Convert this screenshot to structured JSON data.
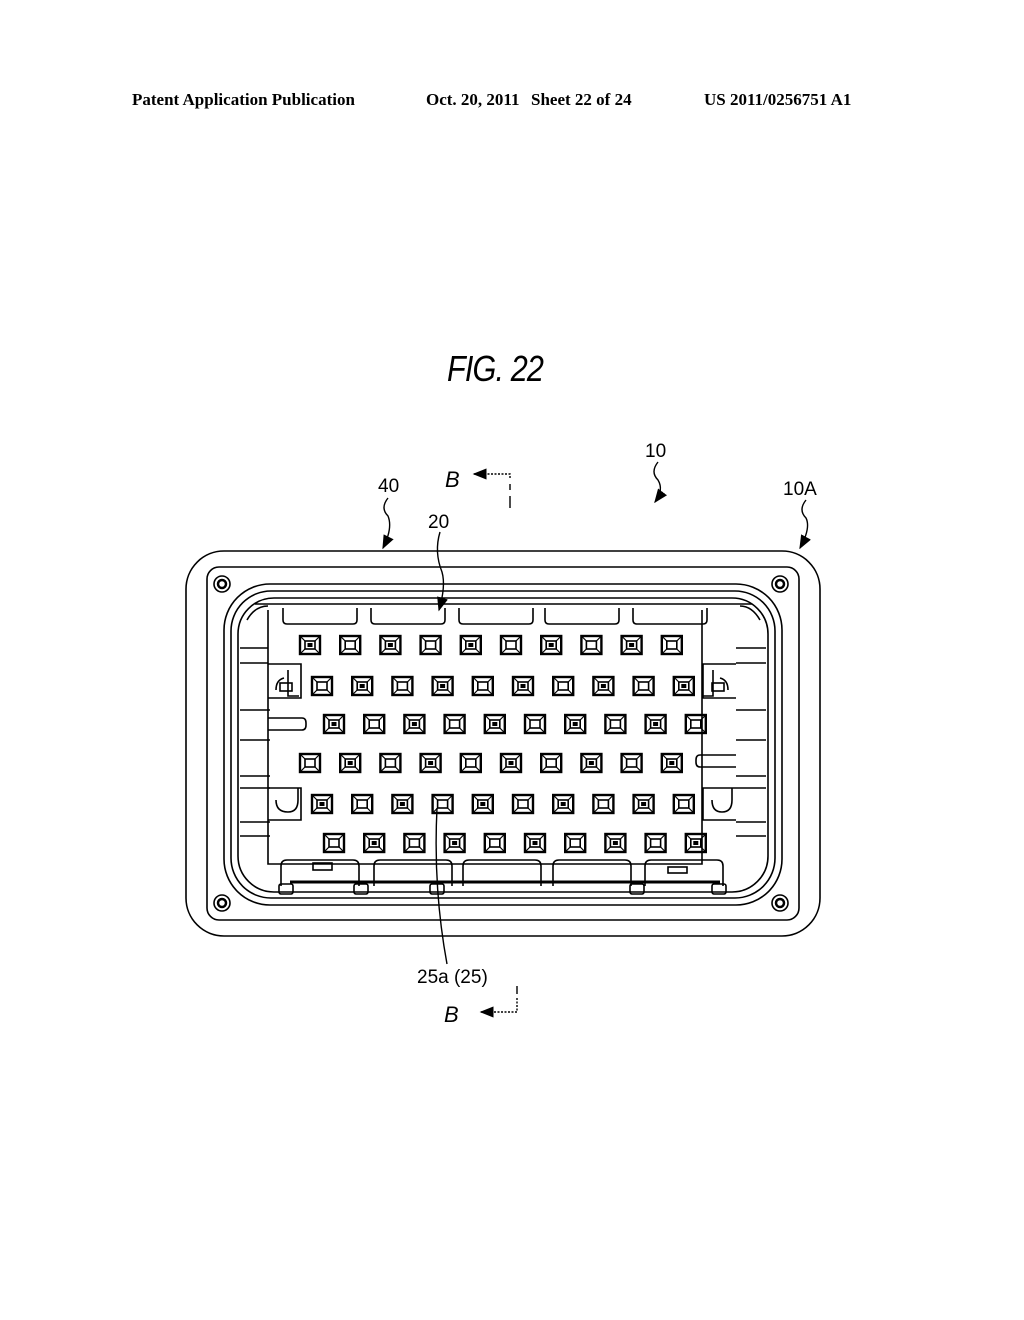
{
  "header": {
    "publication": "Patent Application Publication",
    "date": "Oct. 20, 2011",
    "sheet": "Sheet 22 of 24",
    "number": "US 2011/0256751 A1"
  },
  "figure": {
    "title": "FIG. 22",
    "labels": {
      "connector": "10",
      "housing_outer": "10A",
      "seal": "40",
      "inner_housing": "20",
      "terminal_cavity": "25a (25)",
      "section_top": "B",
      "section_bottom": "B"
    },
    "pin_grid": {
      "rows": 6,
      "pins_per_row": 10
    }
  }
}
